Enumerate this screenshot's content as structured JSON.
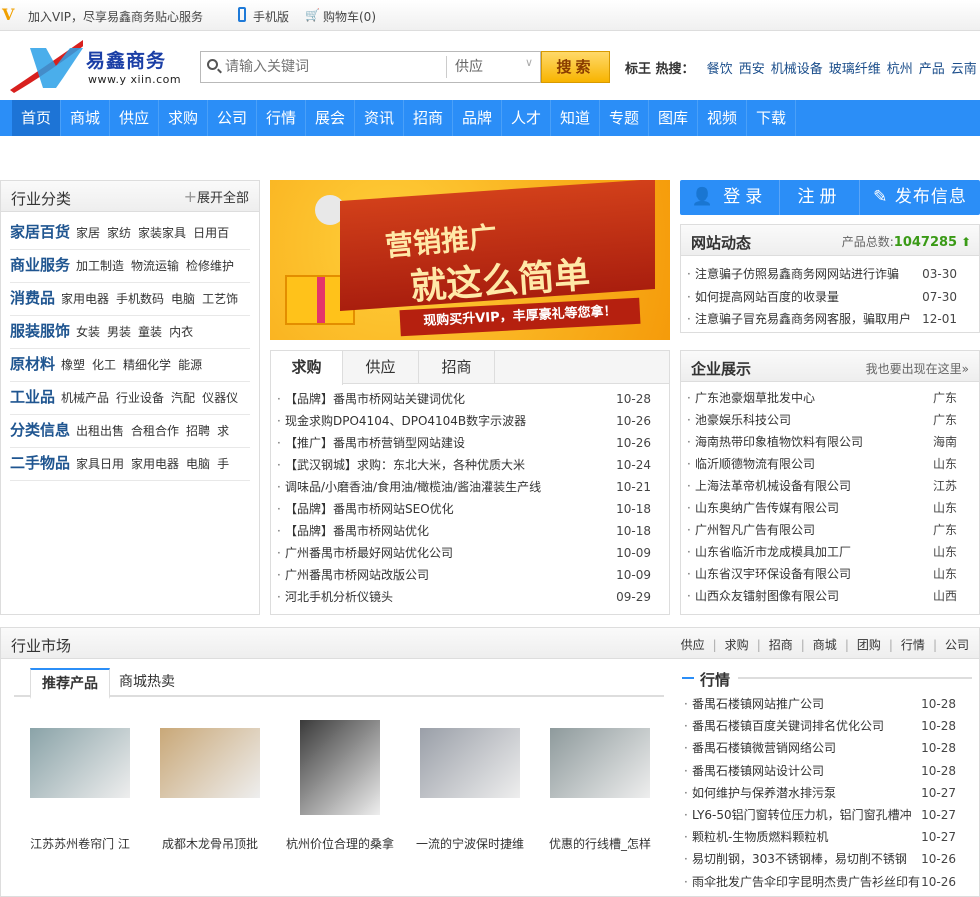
{
  "topbar": {
    "vip_icon": "V",
    "vip_text": "加入VIP，尽享易鑫商务贴心服务",
    "mobile": "手机版",
    "cart": "购物车(0)"
  },
  "header": {
    "logo_name": "易鑫商务",
    "logo_url": "www.y xiin.com",
    "search_placeholder": "请输入关键词",
    "search_type": "供应",
    "search_button": "搜索",
    "hot_label": "标王 热搜：",
    "hot": [
      "餐饮",
      "西安",
      "机械设备",
      "玻璃纤维",
      "杭州",
      "产品",
      "云南"
    ]
  },
  "nav": [
    "首页",
    "商城",
    "供应",
    "求购",
    "公司",
    "行情",
    "展会",
    "资讯",
    "招商",
    "品牌",
    "人才",
    "知道",
    "专题",
    "图库",
    "视频",
    "下载"
  ],
  "categories": {
    "title": "行业分类",
    "expand": "展开全部",
    "rows": [
      {
        "name": "家居百货",
        "items": [
          "家居",
          "家纺",
          "家装家具",
          "日用百"
        ]
      },
      {
        "name": "商业服务",
        "items": [
          "加工制造",
          "物流运输",
          "检修维护"
        ]
      },
      {
        "name": "消费品",
        "items": [
          "家用电器",
          "手机数码",
          "电脑",
          "工艺饰"
        ]
      },
      {
        "name": "服装服饰",
        "items": [
          "女装",
          "男装",
          "童装",
          "内衣"
        ]
      },
      {
        "name": "原材料",
        "items": [
          "橡塑",
          "化工",
          "精细化学",
          "能源"
        ]
      },
      {
        "name": "工业品",
        "items": [
          "机械产品",
          "行业设备",
          "汽配",
          "仪器仪"
        ]
      },
      {
        "name": "分类信息",
        "items": [
          "出租出售",
          "合租合作",
          "招聘",
          "求"
        ]
      },
      {
        "name": "二手物品",
        "items": [
          "家具日用",
          "家用电器",
          "电脑",
          "手"
        ]
      }
    ]
  },
  "banner": {
    "line1": "营销推广",
    "line2": "就这么简单",
    "line3": "现购买升VIP，丰厚豪礼等您拿！"
  },
  "info_tabs": {
    "tabs": [
      "求购",
      "供应",
      "招商"
    ],
    "active": 0,
    "items": [
      {
        "t": "【品牌】番禺市桥网站关键词优化",
        "d": "10-28"
      },
      {
        "t": "现金求购DPO4104、DPO4104B数字示波器",
        "d": "10-26"
      },
      {
        "t": "【推广】番禺市桥营销型网站建设",
        "d": "10-26"
      },
      {
        "t": "【武汉钢城】求购：东北大米，各种优质大米",
        "d": "10-24"
      },
      {
        "t": "调味品/小磨香油/食用油/橄榄油/酱油灌装生产线",
        "d": "10-21"
      },
      {
        "t": "【品牌】番禺市桥网站SEO优化",
        "d": "10-18"
      },
      {
        "t": "【品牌】番禺市桥网站优化",
        "d": "10-18"
      },
      {
        "t": "广州番禺市桥最好网站优化公司",
        "d": "10-09"
      },
      {
        "t": "广州番禺市桥网站改版公司",
        "d": "10-09"
      },
      {
        "t": "河北手机分析仪镜头",
        "d": "09-29"
      }
    ]
  },
  "auth": {
    "login": "登录",
    "register": "注册",
    "publish": "发布信息"
  },
  "site_news": {
    "title": "网站动态",
    "count_label": "产品总数:",
    "count": "1047285",
    "items": [
      {
        "t": "注意骗子仿照易鑫商务网网站进行诈骗",
        "d": "03-30"
      },
      {
        "t": "如何提高网站百度的收录量",
        "d": "07-30"
      },
      {
        "t": "注意骗子冒充易鑫商务网客服，骗取用户",
        "d": "12-01"
      }
    ]
  },
  "companies": {
    "title": "企业展示",
    "more": "我也要出现在这里»",
    "items": [
      {
        "t": "广东池豪烟草批发中心",
        "r": "广东"
      },
      {
        "t": "池豪娱乐科技公司",
        "r": "广东"
      },
      {
        "t": "海南热带印象植物饮料有限公司",
        "r": "海南"
      },
      {
        "t": "临沂顺德物流有限公司",
        "r": "山东"
      },
      {
        "t": "上海法革帝机械设备有限公司",
        "r": "江苏"
      },
      {
        "t": "山东奥纳广告传媒有限公司",
        "r": "山东"
      },
      {
        "t": "广州智凡广告有限公司",
        "r": "广东"
      },
      {
        "t": "山东省临沂市龙成模具加工厂",
        "r": "山东"
      },
      {
        "t": "山东省汉宇环保设备有限公司",
        "r": "山东"
      },
      {
        "t": "山西众友镭射图像有限公司",
        "r": "山西"
      }
    ]
  },
  "market": {
    "title": "行业市场",
    "links": [
      "供应",
      "求购",
      "招商",
      "商城",
      "团购",
      "行情",
      "公司"
    ],
    "tabs": [
      "推荐产品",
      "商城热卖"
    ],
    "products": [
      "江苏苏州卷帘门 江",
      "成都木龙骨吊顶批",
      "杭州价位合理的桑拿",
      "一流的宁波保时捷维",
      "优惠的行线槽_怎样"
    ],
    "quotes_title": "行情",
    "quotes": [
      {
        "t": "番禺石楼镇网站推广公司",
        "d": "10-28"
      },
      {
        "t": "番禺石楼镇百度关键词排名优化公司",
        "d": "10-28"
      },
      {
        "t": "番禺石楼镇微营销网络公司",
        "d": "10-28"
      },
      {
        "t": "番禺石楼镇网站设计公司",
        "d": "10-28"
      },
      {
        "t": "如何维护与保养潜水排污泵",
        "d": "10-27"
      },
      {
        "t": "LY6-50铝门窗转位压力机，铝门窗孔槽冲",
        "d": "10-27"
      },
      {
        "t": "颗粒机-生物质燃料颗粒机",
        "d": "10-27"
      },
      {
        "t": "易切削钢，303不锈钢棒，易切削不锈钢",
        "d": "10-26"
      },
      {
        "t": "雨伞批发广告伞印字昆明杰贵广告衫丝印有",
        "d": "10-26"
      }
    ]
  },
  "colors": {
    "nav": "#2b8ef7",
    "nav_active": "#1d74d6",
    "category": "#1f5590",
    "count": "#3a9a16",
    "search_btn": "#f8b400"
  }
}
